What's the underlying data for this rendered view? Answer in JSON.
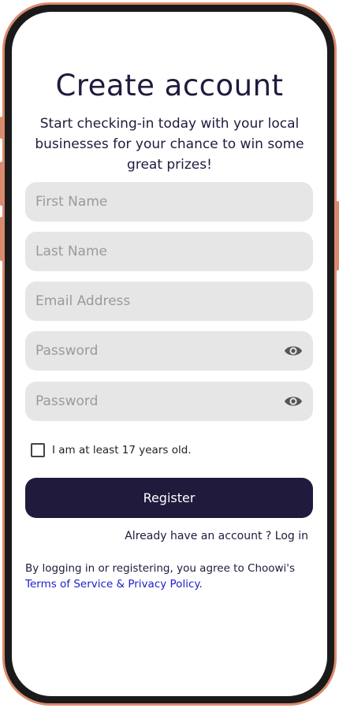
{
  "header": {
    "title": "Create account",
    "subtitle": "Start checking-in today with your local businesses for your chance to win some great prizes!"
  },
  "form": {
    "first_name_placeholder": "First Name",
    "last_name_placeholder": "Last Name",
    "email_placeholder": "Email Address",
    "password_placeholder": "Password",
    "confirm_password_placeholder": "Password",
    "age_checkbox_label": "I am at least 17 years old.",
    "age_checkbox_checked": false,
    "register_label": "Register"
  },
  "footer": {
    "login_prompt": "Already have an account ? Log in",
    "legal_text": "By logging in or registering, you agree to Choowi's",
    "legal_link": "Terms of Service & Privacy Policy",
    "legal_end": "."
  },
  "colors": {
    "primary": "#201a3d",
    "field_bg": "#e6e6e6",
    "link": "#1c1fc7",
    "frame": "#d98b6e"
  },
  "icons": {
    "password_toggle": "eye-icon"
  }
}
